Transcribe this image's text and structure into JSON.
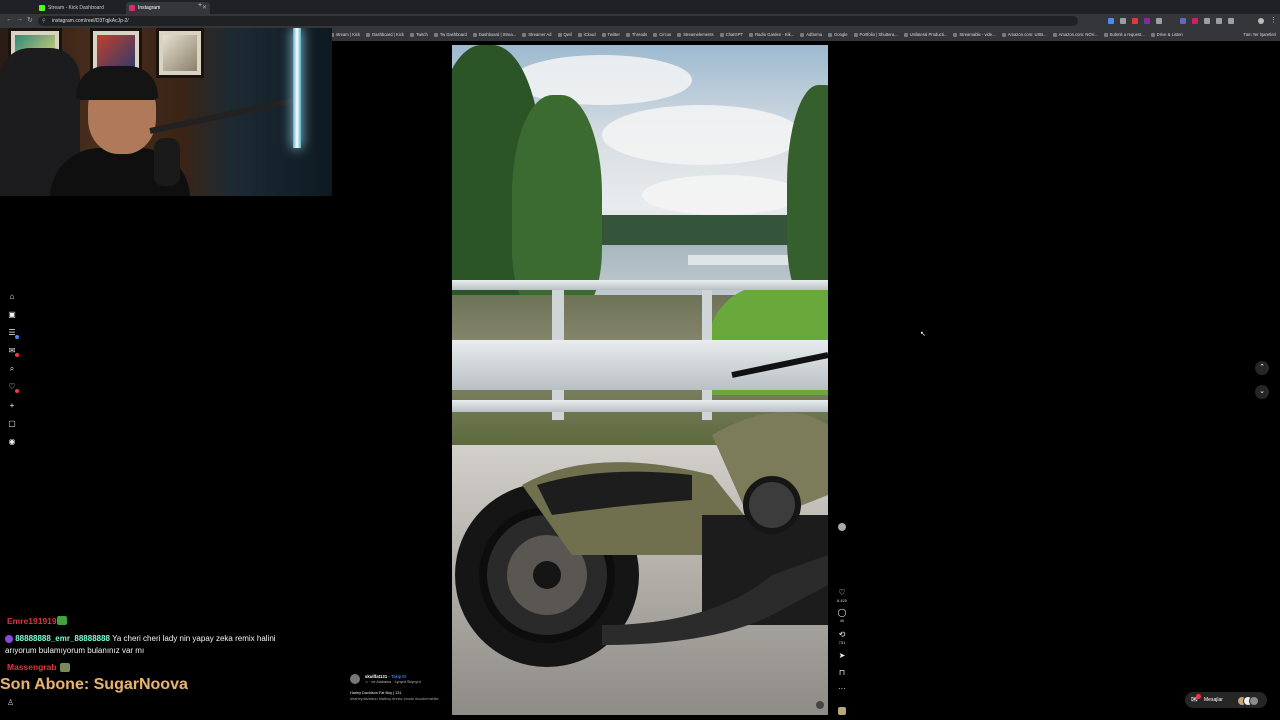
{
  "browser": {
    "tabs": [
      {
        "label": "Stream - Kick Dashboard",
        "favicon_color": "#53fc18"
      },
      {
        "label": "Instagram",
        "favicon_color": "#d62976"
      }
    ],
    "url": "instagram.com/reel/D3TqjkAcJp-2/",
    "bookmarks": [
      "stream | Kick",
      "Dashboard | Kick",
      "Twitch",
      "Tw Dashboard",
      "Dashboard | Strea...",
      "Streamer Ad",
      "Qwil",
      "iCloud",
      "Twitter",
      "Threads",
      "Circus",
      "Streamelements",
      "ChatGPT",
      "Radio Garden - Kik...",
      "Adfarma",
      "Google",
      "Portfolio | Shuttera...",
      "Unilateral Producti...",
      "Streamable - vide...",
      "Amazon.com: USB...",
      "Amazon.com: NOV...",
      "Submit a request...",
      "Drive & Listen"
    ],
    "bookmarks_more": "Tüm Yer İşaretleri"
  },
  "sidebar": {
    "icons": [
      "home-icon",
      "reels-icon",
      "explore-icon",
      "notifications-icon",
      "search-icon",
      "likes-icon",
      "create-icon",
      "profile-icon",
      "threads-icon"
    ]
  },
  "reel": {
    "username": "skullfat131",
    "follow_label": "Takip Et",
    "audio": "♫ · ne Alabama · Lynyrd Skynyrd",
    "caption_title": "Harley Davidson Fat Boy | 131",
    "hashtags": "#harleydavidson #fatboy #relax #moto #customabike",
    "counts": {
      "likes": "6.420",
      "comments": "40",
      "shares": "731"
    }
  },
  "chat": {
    "messages": [
      {
        "user": "Emre191919",
        "text": ""
      },
      {
        "user": "88888888_emr_88888888",
        "text": "Ya cheri cheri lady nin yapay zeka remix halini arıyorum bulamıyorum bulanınız var mı"
      },
      {
        "user": "Massengrab",
        "text": ""
      }
    ],
    "last_sub_label": "Son Abone: SugarNoova"
  },
  "messages_label": "Mesajlar",
  "colors": {
    "chat_name_red": "#e0343f",
    "chat_user_cyan": "#7fffd4",
    "last_sub_gold": "#e7b46e",
    "notification_red": "#ff3040"
  }
}
